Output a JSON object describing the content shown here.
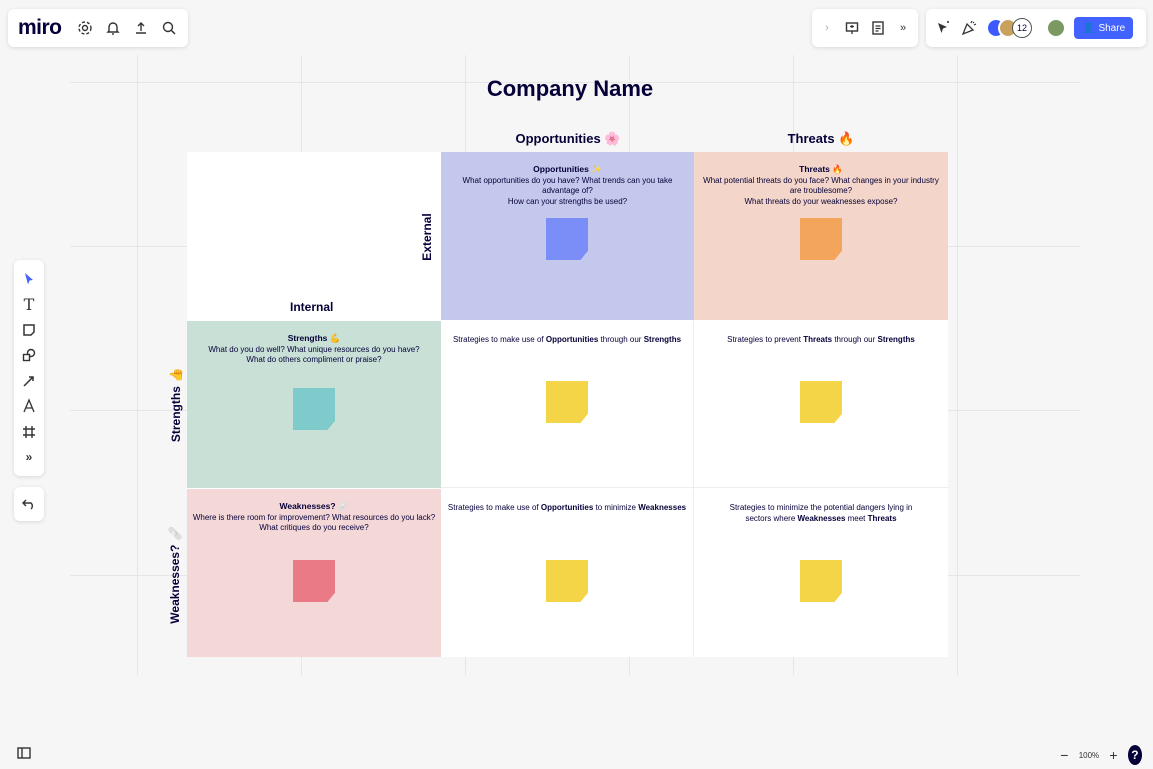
{
  "topbar": {
    "logo": "miro",
    "icons": [
      "settings-icon",
      "bell-icon",
      "upload-icon",
      "search-icon"
    ]
  },
  "collab": {
    "count": "12",
    "share_label": "Share"
  },
  "left_tools": [
    "select-icon",
    "text-icon",
    "sticky-note-icon",
    "shapes-icon",
    "pen-arrow-icon",
    "pen-icon",
    "frame-icon",
    "more-icon"
  ],
  "zoom": {
    "level": "100%",
    "minus": "−",
    "plus": "+",
    "help": "?"
  },
  "board": {
    "title": "Company Name",
    "col_opportunities": "Opportunities 🌸",
    "col_threats": "Threats 🔥",
    "label_internal": "Internal",
    "label_external": "External",
    "label_strengths": "Strengths 👍",
    "label_weaknesses": "Weaknesses? 🩹",
    "opportunities": {
      "title": "Opportunities ✨",
      "desc": "What opportunities do you have? What trends can you take advantage of?\nHow can your strengths be used?"
    },
    "threats": {
      "title": "Threats 🔥",
      "desc": "What potential threats do you face? What changes in your industry are troublesome?\nWhat threats do your weaknesses expose?"
    },
    "strengths": {
      "title": "Strengths 💪",
      "desc": "What do you do well? What unique resources do you have?\nWhat do others compliment or praise?"
    },
    "weaknesses": {
      "title": "Weaknesses? 🩹",
      "desc": "Where is there room for improvement? What resources do you lack?\nWhat critiques do you receive?"
    },
    "so": {
      "pre": "Strategies to make use of ",
      "b1": "Opportunities",
      "mid": " through our ",
      "b2": "Strengths"
    },
    "st": {
      "pre": "Strategies to prevent ",
      "b1": "Threats",
      "mid": " through our ",
      "b2": "Strengths"
    },
    "wo": {
      "pre": "Strategies to make use of ",
      "b1": "Opportunities",
      "mid": " to minimize ",
      "b2": "Weaknesses"
    },
    "wt": {
      "pre": "Strategies to minimize the potential dangers lying in sectors where ",
      "b1": "Weaknesses",
      "mid": " meet ",
      "b2": "Threats"
    }
  },
  "colors": {
    "opportunities_bg": "#c5c8ed",
    "threats_bg": "#f3d6c9",
    "strengths_bg": "#c8e0d6",
    "weaknesses_bg": "#f4d8d8",
    "sticky_blue": "#7b8ef7",
    "sticky_orange": "#f3a55b",
    "sticky_teal": "#7fcaca",
    "sticky_red": "#ea7b86",
    "sticky_yellow": "#f5d548",
    "accent": "#4262ff"
  }
}
